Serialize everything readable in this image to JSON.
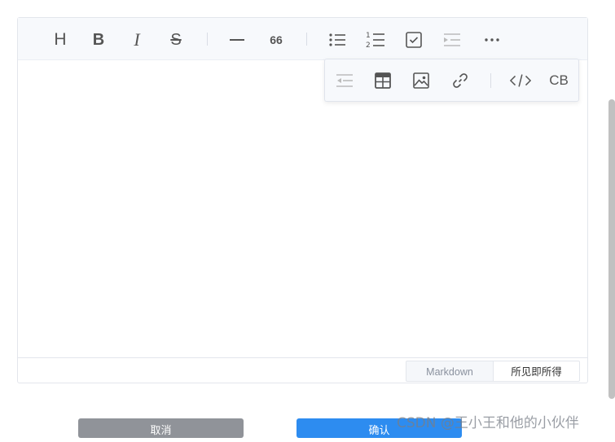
{
  "toolbar": {
    "heading_glyph": "H",
    "bold_glyph": "B",
    "italic_glyph": "I",
    "strike_glyph": "S",
    "quote_glyph": "66"
  },
  "dropdown": {
    "codeblock_glyph": "CB"
  },
  "footer": {
    "markdown_label": "Markdown",
    "wysiwyg_label": "所见即所得"
  },
  "actions": {
    "cancel_label": "取消",
    "confirm_label": "确认"
  },
  "watermark": {
    "text": "CSDN @王小王和他的小伙伴"
  },
  "colors": {
    "confirm": "#2d8cf0",
    "cancel": "#909399",
    "toolbar_bg": "#f7f9fc"
  }
}
